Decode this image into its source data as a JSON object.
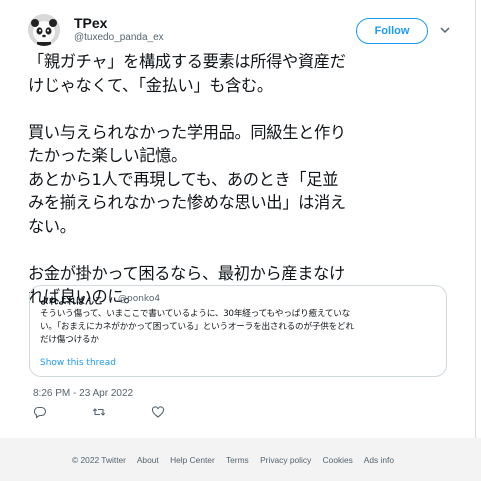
{
  "author": {
    "name": "TPex",
    "handle": "@tuxedo_panda_ex"
  },
  "follow_label": "Follow",
  "tweet_text": "「親ガチャ」を構成する要素は所得や資産だ\nけじゃなくて、「金払い」も含む。\n\n買い与えられなかった学用品。同級生と作り\nたかった楽しい記憶。\nあとから1人で再現しても、あのとき「足並\nみを揃えられなかった惨めな思い出」は消え\nない。\n\nお金が掛かって困るなら、最初から産まなけ\nれば良いのに。",
  "quote": {
    "name": "よれよれぱんこ",
    "handle": "@ponko4",
    "text": "そういう傷って、いまここで書いているように、30年経ってもやっぱり癒えていな\nい。「おまえにカネがかかって困っている」というオーラを出されるのが子供をどれ\nだけ傷つけるか",
    "show_thread": "Show this thread"
  },
  "timestamp": "8:26 PM - 23 Apr 2022",
  "icons": {
    "reply": "reply-icon",
    "retweet": "retweet-icon",
    "like": "heart-icon",
    "more": "chevron-down-icon"
  },
  "footer": {
    "copyright": "© 2022 Twitter",
    "links": [
      "About",
      "Help Center",
      "Terms",
      "Privacy policy",
      "Cookies",
      "Ads info"
    ]
  },
  "colors": {
    "accent": "#1d9bf0",
    "muted": "#536471",
    "footer_bg": "#f3f3f3"
  }
}
